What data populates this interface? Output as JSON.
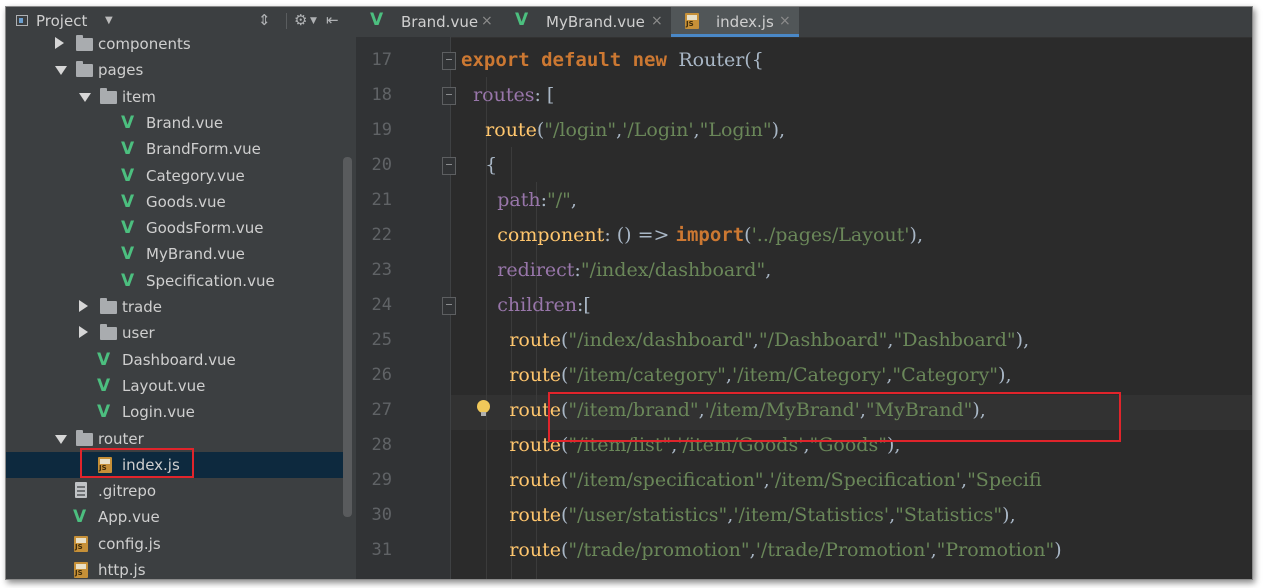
{
  "project_panel": {
    "title": "Project",
    "tree": [
      {
        "label": "components",
        "type": "folder",
        "depth": 1,
        "state": "collapsed"
      },
      {
        "label": "pages",
        "type": "folder",
        "depth": 1,
        "state": "expanded"
      },
      {
        "label": "item",
        "type": "folder",
        "depth": 2,
        "state": "expanded"
      },
      {
        "label": "Brand.vue",
        "type": "vue",
        "depth": 3
      },
      {
        "label": "BrandForm.vue",
        "type": "vue",
        "depth": 3
      },
      {
        "label": "Category.vue",
        "type": "vue",
        "depth": 3
      },
      {
        "label": "Goods.vue",
        "type": "vue",
        "depth": 3
      },
      {
        "label": "GoodsForm.vue",
        "type": "vue",
        "depth": 3
      },
      {
        "label": "MyBrand.vue",
        "type": "vue",
        "depth": 3
      },
      {
        "label": "Specification.vue",
        "type": "vue",
        "depth": 3
      },
      {
        "label": "trade",
        "type": "folder",
        "depth": 2,
        "state": "collapsed"
      },
      {
        "label": "user",
        "type": "folder",
        "depth": 2,
        "state": "collapsed"
      },
      {
        "label": "Dashboard.vue",
        "type": "vue",
        "depth": 2
      },
      {
        "label": "Layout.vue",
        "type": "vue",
        "depth": 2
      },
      {
        "label": "Login.vue",
        "type": "vue",
        "depth": 2
      },
      {
        "label": "router",
        "type": "folder",
        "depth": 1,
        "state": "expanded"
      },
      {
        "label": "index.js",
        "type": "js",
        "depth": 2,
        "selected": true
      },
      {
        "label": ".gitrepo",
        "type": "file",
        "depth": 1
      },
      {
        "label": "App.vue",
        "type": "vue",
        "depth": 1
      },
      {
        "label": "config.js",
        "type": "js",
        "depth": 1
      },
      {
        "label": "http.js",
        "type": "js",
        "depth": 1
      }
    ]
  },
  "editor": {
    "tabs": [
      {
        "label": "Brand.vue",
        "icon": "vue-icon",
        "close": "×",
        "active": false
      },
      {
        "label": "MyBrand.vue",
        "icon": "vue-icon",
        "close": "×",
        "active": false
      },
      {
        "label": "index.js",
        "icon": "js-icon",
        "close": "×",
        "active": true
      }
    ],
    "lines": [
      {
        "no": "17",
        "fold": true,
        "tokens": [
          [
            "kw",
            "export default new "
          ],
          [
            "plain",
            "Router({"
          ]
        ]
      },
      {
        "no": "18",
        "fold": true,
        "tokens": [
          [
            "plain",
            "  "
          ],
          [
            "prop",
            "routes"
          ],
          [
            "plain",
            ": ["
          ]
        ]
      },
      {
        "no": "19",
        "fold": false,
        "tokens": [
          [
            "plain",
            "    "
          ],
          [
            "func",
            "route"
          ],
          [
            "plain",
            "("
          ],
          [
            "str",
            "\"/login\""
          ],
          [
            "plain",
            ","
          ],
          [
            "str",
            "'/Login'"
          ],
          [
            "plain",
            ","
          ],
          [
            "str",
            "\"Login\""
          ],
          [
            "plain",
            "),"
          ]
        ]
      },
      {
        "no": "20",
        "fold": true,
        "tokens": [
          [
            "plain",
            "    {"
          ]
        ]
      },
      {
        "no": "21",
        "fold": false,
        "tokens": [
          [
            "plain",
            "      "
          ],
          [
            "prop",
            "path"
          ],
          [
            "plain",
            ":"
          ],
          [
            "str",
            "\"/\""
          ],
          [
            "plain",
            ","
          ]
        ]
      },
      {
        "no": "22",
        "fold": false,
        "tokens": [
          [
            "plain",
            "      "
          ],
          [
            "func",
            "component"
          ],
          [
            "plain",
            ": () => "
          ],
          [
            "kw",
            "import"
          ],
          [
            "plain",
            "("
          ],
          [
            "str",
            "'../pages/Layout'"
          ],
          [
            "plain",
            "),"
          ]
        ]
      },
      {
        "no": "23",
        "fold": false,
        "tokens": [
          [
            "plain",
            "      "
          ],
          [
            "prop",
            "redirect"
          ],
          [
            "plain",
            ":"
          ],
          [
            "str",
            "\"/index/dashboard\""
          ],
          [
            "plain",
            ","
          ]
        ]
      },
      {
        "no": "24",
        "fold": true,
        "tokens": [
          [
            "plain",
            "      "
          ],
          [
            "prop",
            "children"
          ],
          [
            "plain",
            ":["
          ]
        ]
      },
      {
        "no": "25",
        "fold": false,
        "tokens": [
          [
            "plain",
            "        "
          ],
          [
            "func",
            "route"
          ],
          [
            "plain",
            "("
          ],
          [
            "str",
            "\"/index/dashboard\""
          ],
          [
            "plain",
            ","
          ],
          [
            "str",
            "\"/Dashboard\""
          ],
          [
            "plain",
            ","
          ],
          [
            "str",
            "\"Dashboard\""
          ],
          [
            "plain",
            "),"
          ]
        ]
      },
      {
        "no": "26",
        "fold": false,
        "tokens": [
          [
            "plain",
            "        "
          ],
          [
            "func",
            "route"
          ],
          [
            "plain",
            "("
          ],
          [
            "str",
            "\"/item/category\""
          ],
          [
            "plain",
            ","
          ],
          [
            "str",
            "'/item/Category'"
          ],
          [
            "plain",
            ","
          ],
          [
            "str",
            "\"Category\""
          ],
          [
            "plain",
            "),"
          ]
        ]
      },
      {
        "no": "27",
        "fold": false,
        "current": true,
        "tokens": [
          [
            "plain",
            "        "
          ],
          [
            "func",
            "route"
          ],
          [
            "plain",
            "("
          ],
          [
            "str",
            "\"/item/brand\""
          ],
          [
            "plain",
            ","
          ],
          [
            "str",
            "'/item/MyBrand'"
          ],
          [
            "plain",
            ","
          ],
          [
            "str",
            "\"MyBrand\""
          ],
          [
            "plain",
            "),"
          ]
        ]
      },
      {
        "no": "28",
        "fold": false,
        "tokens": [
          [
            "plain",
            "        "
          ],
          [
            "func",
            "route"
          ],
          [
            "plain",
            "("
          ],
          [
            "str",
            "\"/item/list\""
          ],
          [
            "plain",
            ","
          ],
          [
            "str",
            "'/item/Goods'"
          ],
          [
            "plain",
            ","
          ],
          [
            "str",
            "\"Goods\""
          ],
          [
            "plain",
            "),"
          ]
        ]
      },
      {
        "no": "29",
        "fold": false,
        "tokens": [
          [
            "plain",
            "        "
          ],
          [
            "func",
            "route"
          ],
          [
            "plain",
            "("
          ],
          [
            "str",
            "\"/item/specification\""
          ],
          [
            "plain",
            ","
          ],
          [
            "str",
            "'/item/Specification'"
          ],
          [
            "plain",
            ","
          ],
          [
            "str",
            "\"Specifi"
          ]
        ]
      },
      {
        "no": "30",
        "fold": false,
        "tokens": [
          [
            "plain",
            "        "
          ],
          [
            "func",
            "route"
          ],
          [
            "plain",
            "("
          ],
          [
            "str",
            "\"/user/statistics\""
          ],
          [
            "plain",
            ","
          ],
          [
            "str",
            "'/item/Statistics'"
          ],
          [
            "plain",
            ","
          ],
          [
            "str",
            "\"Statistics\""
          ],
          [
            "plain",
            "),"
          ]
        ]
      },
      {
        "no": "31",
        "fold": false,
        "tokens": [
          [
            "plain",
            "        "
          ],
          [
            "func",
            "route"
          ],
          [
            "plain",
            "("
          ],
          [
            "str",
            "\"/trade/promotion\""
          ],
          [
            "plain",
            ","
          ],
          [
            "str",
            "'/trade/Promotion'"
          ],
          [
            "plain",
            ","
          ],
          [
            "str",
            "\"Promotion\""
          ],
          [
            "plain",
            ")"
          ]
        ]
      }
    ]
  },
  "colors": {
    "keyword": "#cc7832",
    "string": "#6a8759",
    "property": "#9876aa",
    "function": "#ffc66d",
    "highlight_box": "#e0242b",
    "vue": "#4cbf7f"
  }
}
